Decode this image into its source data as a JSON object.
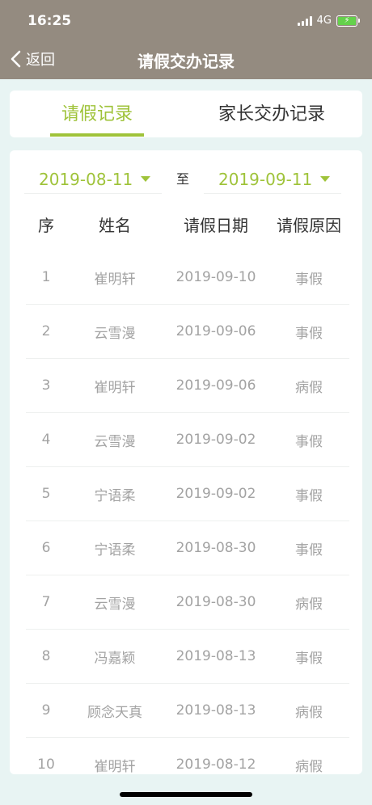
{
  "status": {
    "time": "16:25",
    "network": "4G"
  },
  "nav": {
    "back_label": "返回",
    "title": "请假交办记录"
  },
  "tabs": [
    {
      "label": "请假记录",
      "active": true
    },
    {
      "label": "家长交办记录",
      "active": false
    }
  ],
  "filter": {
    "start_date": "2019-08-11",
    "to_label": "至",
    "end_date": "2019-09-11"
  },
  "table": {
    "columns": [
      "序",
      "姓名",
      "请假日期",
      "请假原因"
    ],
    "rows": [
      [
        "1",
        "崔明轩",
        "2019-09-10",
        "事假"
      ],
      [
        "2",
        "云雪漫",
        "2019-09-06",
        "事假"
      ],
      [
        "3",
        "崔明轩",
        "2019-09-06",
        "病假"
      ],
      [
        "4",
        "云雪漫",
        "2019-09-02",
        "事假"
      ],
      [
        "5",
        "宁语柔",
        "2019-09-02",
        "事假"
      ],
      [
        "6",
        "宁语柔",
        "2019-08-30",
        "事假"
      ],
      [
        "7",
        "云雪漫",
        "2019-08-30",
        "病假"
      ],
      [
        "8",
        "冯嘉颖",
        "2019-08-13",
        "事假"
      ],
      [
        "9",
        "顾念天真",
        "2019-08-13",
        "病假"
      ],
      [
        "10",
        "崔明轩",
        "2019-08-12",
        "病假"
      ]
    ]
  },
  "colors": {
    "accent": "#9fc33a",
    "header_bg": "#948b80",
    "page_bg": "#e8f4f3"
  }
}
